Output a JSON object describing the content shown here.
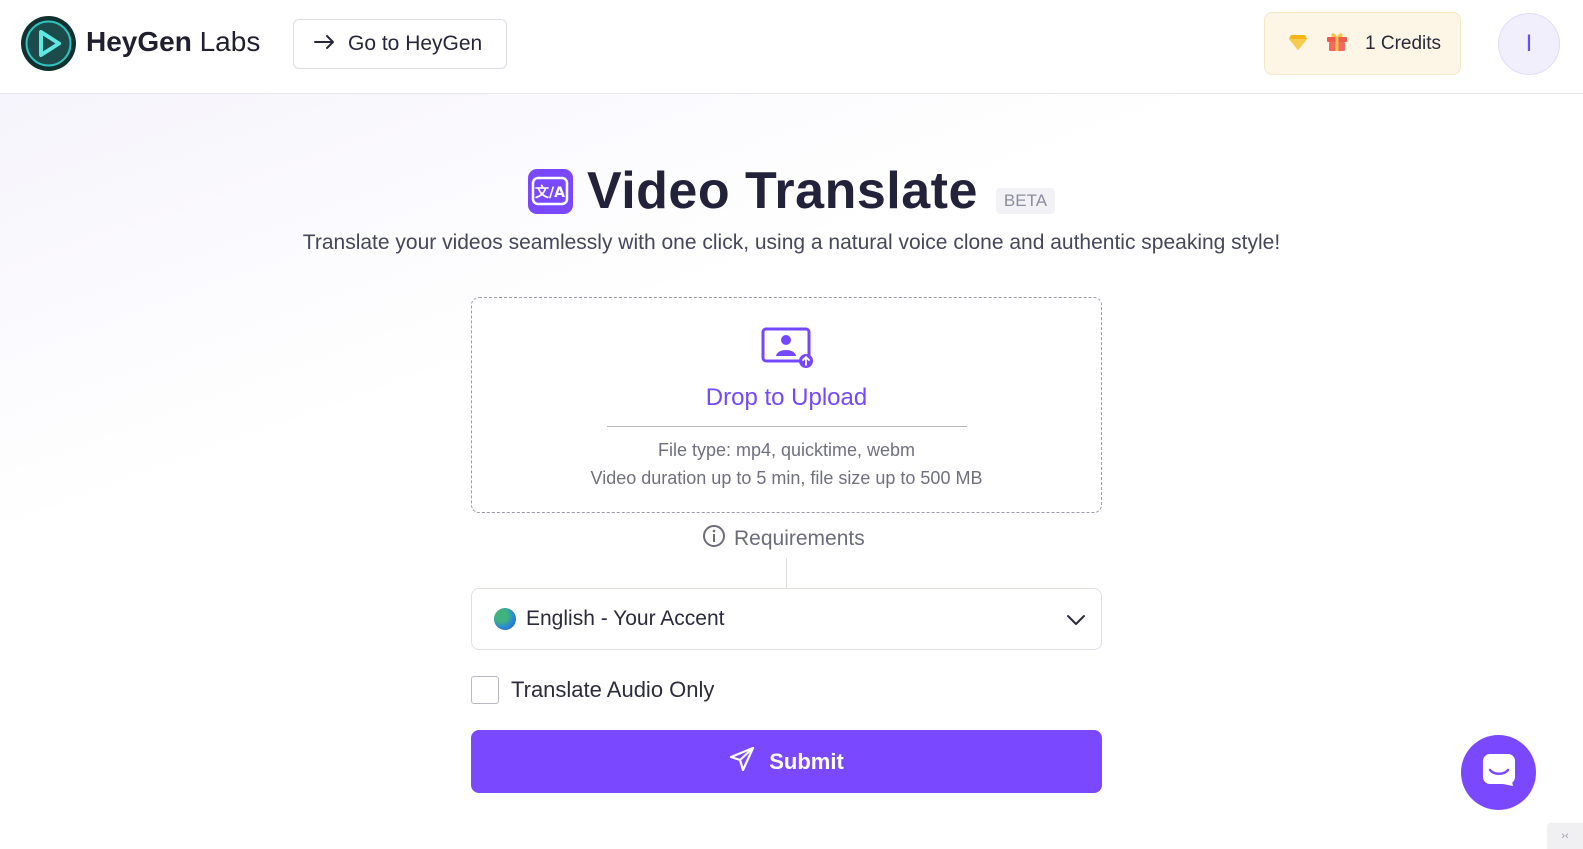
{
  "header": {
    "brand_bold": "HeyGen",
    "brand_light": "Labs",
    "goto_label": "Go to HeyGen",
    "credits_label": "1 Credits",
    "avatar_letter": "I",
    "logo_icon": "heygen-logo-icon",
    "goto_icon": "arrow-right-icon",
    "credits_icons": [
      "diamond-icon",
      "gift-icon"
    ]
  },
  "hero": {
    "title": "Video Translate",
    "badge": "BETA",
    "subtitle": "Translate your videos seamlessly with one click, using a natural voice clone and authentic speaking style!",
    "title_icon_text": "文/A"
  },
  "upload": {
    "title": "Drop to Upload",
    "file_types": "File type: mp4, quicktime, webm",
    "limits": "Video duration up to 5 min, file size up to 500 MB",
    "icon": "video-upload-icon"
  },
  "requirements": {
    "label": "Requirements",
    "icon": "info-icon"
  },
  "language": {
    "selected": "English - Your Accent",
    "icon": "globe-icon",
    "chevron": "chevron-down-icon"
  },
  "options": {
    "audio_only_label": "Translate Audio Only",
    "audio_only_checked": false
  },
  "submit": {
    "label": "Submit",
    "icon": "send-icon"
  },
  "chat": {
    "icon": "chat-icon"
  },
  "colors": {
    "accent": "#7a49ff",
    "text": "#22223a",
    "muted": "#6f6f80"
  }
}
